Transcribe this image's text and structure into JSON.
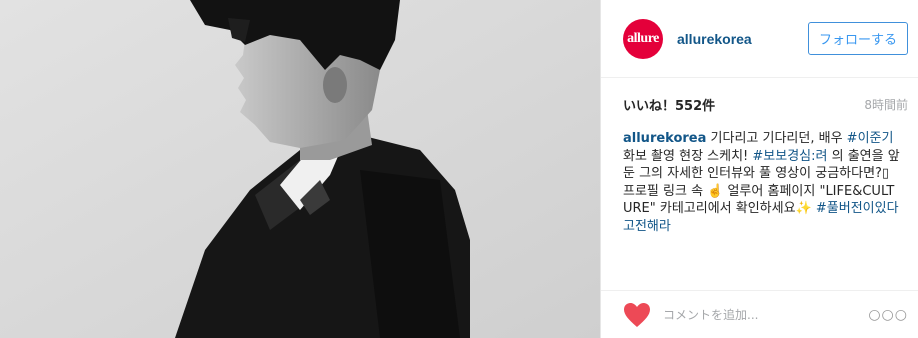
{
  "account": {
    "avatar_text": "allure",
    "username": "allurekorea",
    "follow_label": "フォローする"
  },
  "stats": {
    "likes": "いいね！552件",
    "time": "8時間前"
  },
  "caption": {
    "user": "allurekorea",
    "text_1": " 기다리고 기다리던, 배우 ",
    "tag_1": "#이준기",
    "text_2": " 화보 촬영 현장 스케치! ",
    "tag_2": "#보보경심:려",
    "text_3": " 의 출연을 앞둔 그의 자세한 인터뷰와 풀 영상이 궁금하다면?▯ 프로필 링크 속 ☝️ 얼루어 홈페이지 \"LIFE&CULTURE\" 카테고리에서 확인하세요✨ ",
    "tag_3": "#풀버전이있다고전해라"
  },
  "comment": {
    "placeholder": "コメントを追加..."
  },
  "more_label": "○○○",
  "colors": {
    "link": "#125688",
    "follow_blue": "#3897f0",
    "heart": "#ed4956",
    "brand": "#e4003a"
  }
}
